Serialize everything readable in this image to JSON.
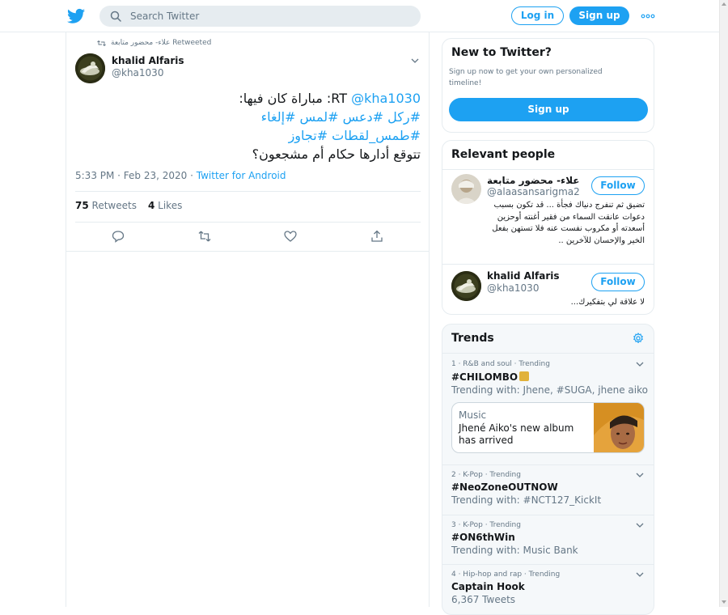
{
  "header": {
    "search_placeholder": "Search Twitter",
    "login_label": "Log in",
    "signup_label": "Sign up"
  },
  "tweet": {
    "retweeted_by": "علاء- محضور متابعة Retweeted",
    "author_name": "khalid Alfaris",
    "author_handle": "@kha1030",
    "line1_prefix": "RT ",
    "line1_mention": "@kha1030",
    "line1_rest": ": مباراة كان فيها:",
    "line2_hashtags": "#ركل #دعس #لمس #إلغاء",
    "line3_hashtags": "#طمس_لقطات #تجاوز",
    "line4": "تتوقع أدارها حكام أم مشجعون؟",
    "timestamp": "5:33 PM · Feb 23, 2020 · ",
    "source": "Twitter for Android",
    "retweets_count": "75",
    "retweets_label": "Retweets",
    "likes_count": "4",
    "likes_label": "Likes"
  },
  "new_to_twitter": {
    "title": "New to Twitter?",
    "description": "Sign up now to get your own personalized timeline!",
    "signup_label": "Sign up"
  },
  "relevant_people": {
    "title": "Relevant people",
    "people": [
      {
        "name": "علاء- محضور متابعة",
        "handle": "@alaasansarigma2",
        "follow_label": "Follow",
        "bio": "تضيق ثم تنفرج دنياك فجأة ... قد تكون بسبب دعوات عانقت السماء من فقير أغنته أوحزين أسعدته أو مكروب نفست عنه فلا تستهن بفعل الخير والإحسان للآخرين .."
      },
      {
        "name": "khalid Alfaris",
        "handle": "@kha1030",
        "follow_label": "Follow",
        "bio": "لا علاقة لي بتفكيرك..."
      }
    ]
  },
  "trends": {
    "title": "Trends",
    "items": [
      {
        "meta": "1 · R&B and soul · Trending",
        "name": "#CHILOMBO",
        "sub": "Trending with: Jhene, #SUGA, jhene aiko",
        "news_category": "Music",
        "news_title": "Jhené Aiko's new album has arrived"
      },
      {
        "meta": "2 · K-Pop · Trending",
        "name": "#NeoZoneOUTNOW",
        "sub": "Trending with: #NCT127_KickIt"
      },
      {
        "meta": "3 · K-Pop · Trending",
        "name": "#ON6thWin",
        "sub": "Trending with: Music Bank"
      },
      {
        "meta": "4 · Hip-hop and rap · Trending",
        "name": "Captain Hook",
        "sub": "6,367 Tweets"
      }
    ]
  },
  "colors": {
    "accent": "#1da1f2",
    "text_primary": "#14171a",
    "text_secondary": "#657786",
    "border": "#e6ecf0",
    "trends_bg": "#f5f8fa"
  },
  "icons": [
    "twitter-logo-icon",
    "search-icon",
    "more-icon",
    "retweet-icon",
    "chevron-down-icon",
    "reply-icon",
    "like-icon",
    "share-icon",
    "settings-gear-icon"
  ]
}
